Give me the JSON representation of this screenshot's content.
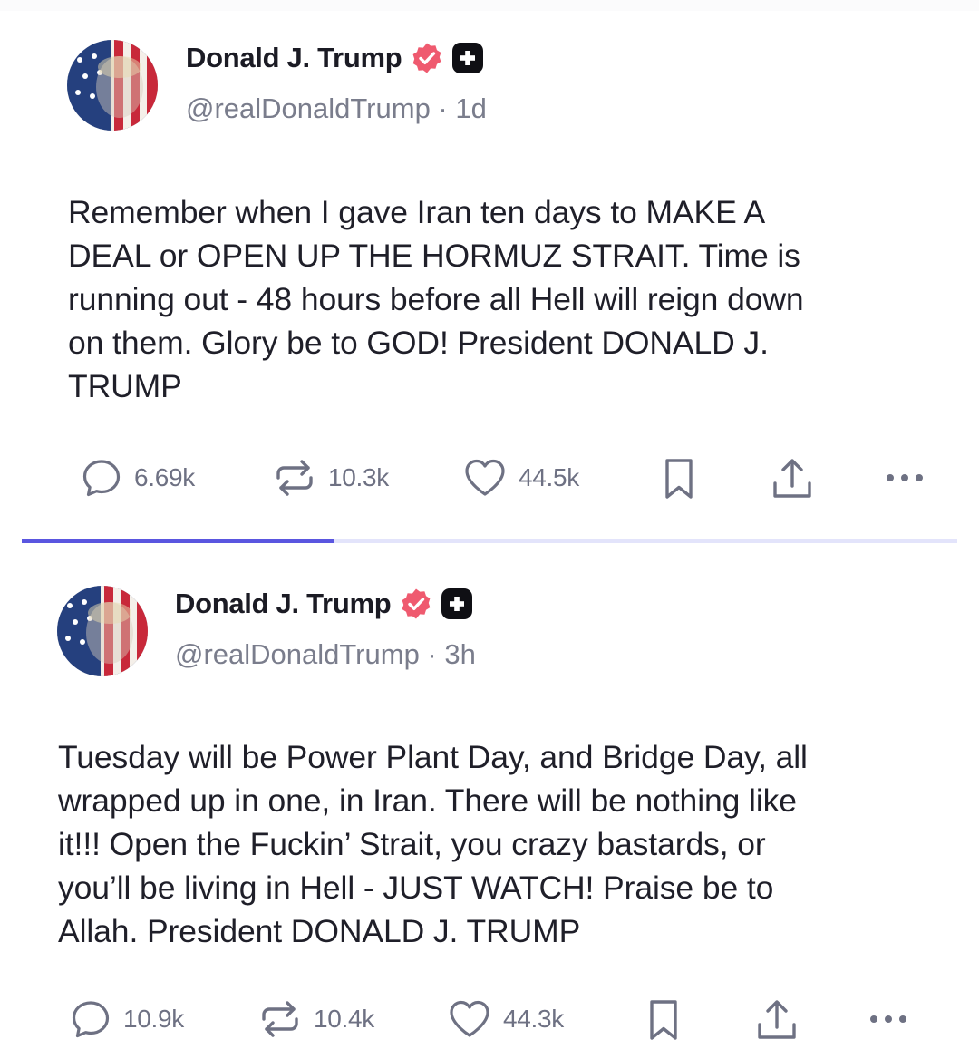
{
  "feed": {
    "progress_fraction": 0.333,
    "posts": [
      {
        "display_name": "Donald J. Trump",
        "handle": "@realDonaldTrump",
        "age": "1d",
        "text": "Remember when I gave Iran ten days to MAKE A\nDEAL or OPEN UP THE HORMUZ STRAIT. Time is\nrunning out - 48 hours before all Hell will reign down\non them. Glory be to GOD! President DONALD J.\nTRUMP",
        "replies": "6.69k",
        "reposts": "10.3k",
        "likes": "44.5k"
      },
      {
        "display_name": "Donald J. Trump",
        "handle": "@realDonaldTrump",
        "age": "3h",
        "text": "Tuesday will be Power Plant Day, and Bridge Day, all\nwrapped up in one, in Iran. There will be nothing like\nit!!! Open the Fuckin’ Strait, you crazy bastards, or\nyou’ll be living in Hell - JUST WATCH! Praise be to\nAllah. President DONALD J. TRUMP",
        "replies": "10.9k",
        "reposts": "10.4k",
        "likes": "44.3k"
      }
    ]
  },
  "icons": {
    "verified": "verified-badge-icon",
    "plus": "plus-badge-icon",
    "reply": "speech-bubble-icon",
    "repost": "repost-arrows-icon",
    "like": "heart-icon",
    "bookmark": "bookmark-icon",
    "share": "share-upload-icon",
    "more": "more-dots-icon"
  },
  "colors": {
    "verified": "#ef5a6f",
    "accent": "#5a56e0",
    "track": "#e3e4fb",
    "muted": "#6e7183"
  }
}
